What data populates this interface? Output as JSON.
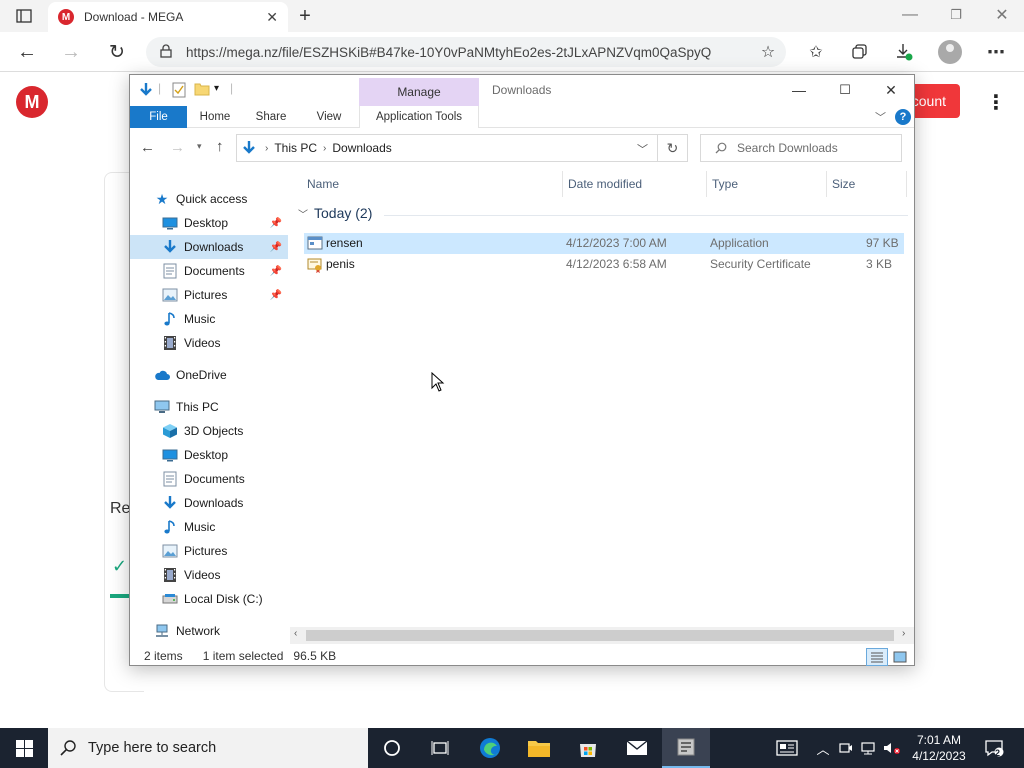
{
  "browser": {
    "tab_title": "Download - MEGA",
    "tab_close": "✕",
    "new_tab": "+",
    "url": "https://mega.nz/file/ESZHSKiB#B47ke-10Y0vPaNMtyhEo2es-2tJLxAPNZVqm0QaSpyQ",
    "window_controls": {
      "minimize": "—",
      "restore": "❐",
      "close": "✕"
    },
    "toolbar_icons": [
      "back-icon",
      "forward-icon",
      "refresh-icon",
      "lock-icon",
      "favorite-add-icon",
      "favorites-icon",
      "collections-icon",
      "downloads-icon",
      "profile-icon",
      "more-icon"
    ]
  },
  "mega": {
    "logo_letter": "M",
    "account_button": "count",
    "menu": "⋮",
    "partial_heading": "Re",
    "check": "✓"
  },
  "explorer": {
    "title": "Downloads",
    "manage_tab": "Manage",
    "ribbon_tabs": {
      "file": "File",
      "home": "Home",
      "share": "Share",
      "view": "View",
      "app_tools": "Application Tools"
    },
    "help": "?",
    "breadcrumb": [
      "This PC",
      "Downloads"
    ],
    "search_placeholder": "Search Downloads",
    "nav": {
      "quick_access": "Quick access",
      "qa_items": [
        {
          "label": "Desktop",
          "icon": "desktop-icon",
          "pinned": true
        },
        {
          "label": "Downloads",
          "icon": "download-arrow-icon",
          "pinned": true
        },
        {
          "label": "Documents",
          "icon": "documents-icon",
          "pinned": true
        },
        {
          "label": "Pictures",
          "icon": "pictures-icon",
          "pinned": true
        },
        {
          "label": "Music",
          "icon": "music-icon",
          "pinned": false
        },
        {
          "label": "Videos",
          "icon": "videos-icon",
          "pinned": false
        }
      ],
      "onedrive": "OneDrive",
      "this_pc": "This PC",
      "pc_items": [
        {
          "label": "3D Objects",
          "icon": "cube-icon"
        },
        {
          "label": "Desktop",
          "icon": "desktop-icon"
        },
        {
          "label": "Documents",
          "icon": "documents-icon"
        },
        {
          "label": "Downloads",
          "icon": "download-arrow-icon"
        },
        {
          "label": "Music",
          "icon": "music-icon"
        },
        {
          "label": "Pictures",
          "icon": "pictures-icon"
        },
        {
          "label": "Videos",
          "icon": "videos-icon"
        },
        {
          "label": "Local Disk (C:)",
          "icon": "disk-icon"
        }
      ],
      "network": "Network"
    },
    "columns": {
      "name": "Name",
      "date": "Date modified",
      "type": "Type",
      "size": "Size"
    },
    "group": "Today (2)",
    "files": [
      {
        "name": "rensen",
        "date": "4/12/2023 7:00 AM",
        "type": "Application",
        "size": "97 KB",
        "selected": true
      },
      {
        "name": "penis",
        "date": "4/12/2023 6:58 AM",
        "type": "Security Certificate",
        "size": "3 KB",
        "selected": false
      }
    ],
    "status": {
      "count": "2 items",
      "selected": "1 item selected",
      "size": "96.5 KB"
    }
  },
  "taskbar": {
    "search_placeholder": "Type here to search",
    "apps": [
      "task-view-icon",
      "edge-icon",
      "file-explorer-icon",
      "store-icon",
      "mail-icon",
      "app-icon"
    ],
    "time": "7:01 AM",
    "date": "4/12/2023",
    "notifications": "2"
  },
  "colors": {
    "accent": "#1979ca",
    "mega_red": "#d9272e",
    "selection": "#cce8ff",
    "manage_tab": "#e4d4f4",
    "taskbar": "#1b2330"
  }
}
